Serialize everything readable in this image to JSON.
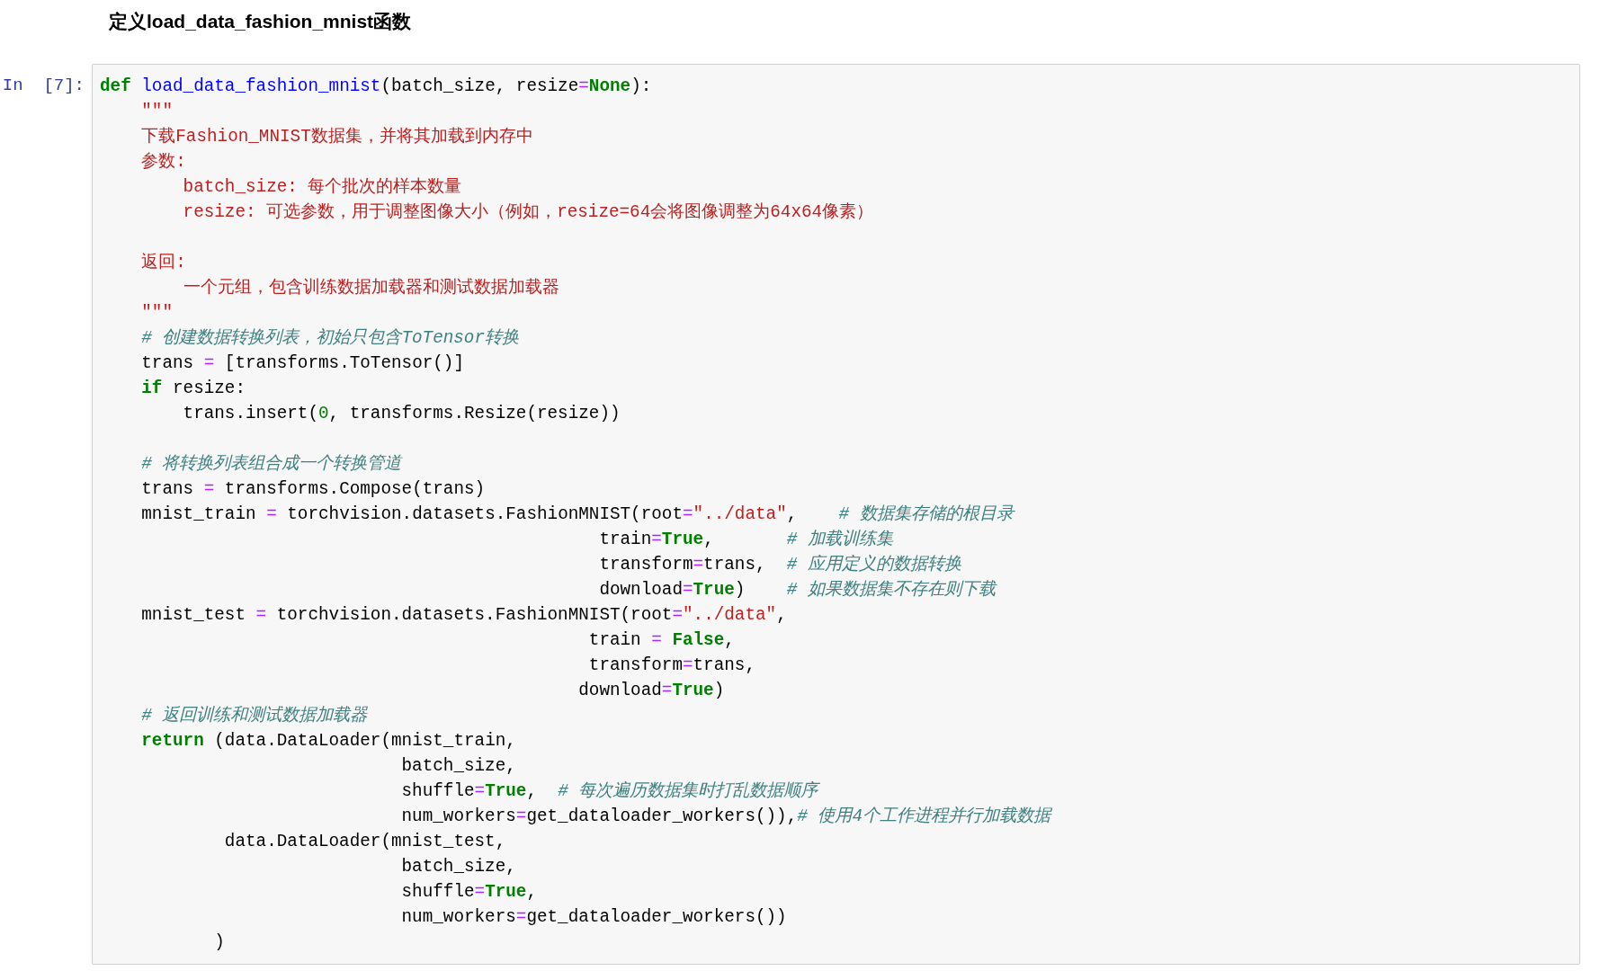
{
  "heading": "定义load_data_fashion_mnist函数",
  "cell": {
    "prompt": "In  [7]:",
    "lines": [
      {
        "kind": "code",
        "tokens": [
          {
            "kind": "kw",
            "text": "def"
          },
          {
            "kind": "fn",
            "text": " load_data_fashion_mnist"
          },
          {
            "kind": "txt",
            "text": "(batch_size, resize"
          },
          {
            "kind": "op",
            "text": "="
          },
          {
            "kind": "kw",
            "text": "None"
          },
          {
            "kind": "txt",
            "text": "):"
          }
        ]
      },
      {
        "kind": "code",
        "tokens": [
          {
            "kind": "str",
            "text": "    \"\"\""
          }
        ]
      },
      {
        "kind": "code",
        "tokens": [
          {
            "kind": "str",
            "text": "    下载Fashion_MNIST数据集，并将其加载到内存中"
          }
        ]
      },
      {
        "kind": "code",
        "tokens": [
          {
            "kind": "str",
            "text": "    参数:"
          }
        ]
      },
      {
        "kind": "code",
        "tokens": [
          {
            "kind": "str",
            "text": "        batch_size: 每个批次的样本数量"
          }
        ]
      },
      {
        "kind": "code",
        "tokens": [
          {
            "kind": "str",
            "text": "        resize: 可选参数，用于调整图像大小（例如，resize=64会将图像调整为64x64像素）"
          }
        ]
      },
      {
        "kind": "blank"
      },
      {
        "kind": "code",
        "tokens": [
          {
            "kind": "str",
            "text": "    返回:"
          }
        ]
      },
      {
        "kind": "code",
        "tokens": [
          {
            "kind": "str",
            "text": "        一个元组，包含训练数据加载器和测试数据加载器"
          }
        ]
      },
      {
        "kind": "code",
        "tokens": [
          {
            "kind": "str",
            "text": "    \"\"\""
          }
        ]
      },
      {
        "kind": "code",
        "tokens": [
          {
            "kind": "cmt",
            "text": "    # 创建数据转换列表，初始只包含ToTensor转换"
          }
        ]
      },
      {
        "kind": "code",
        "tokens": [
          {
            "kind": "txt",
            "text": "    trans "
          },
          {
            "kind": "op",
            "text": "="
          },
          {
            "kind": "txt",
            "text": " [transforms.ToTensor()]"
          }
        ]
      },
      {
        "kind": "code",
        "tokens": [
          {
            "kind": "kw",
            "text": "    if"
          },
          {
            "kind": "txt",
            "text": " resize:"
          }
        ]
      },
      {
        "kind": "code",
        "tokens": [
          {
            "kind": "txt",
            "text": "        trans.insert("
          },
          {
            "kind": "num",
            "text": "0"
          },
          {
            "kind": "txt",
            "text": ", transforms.Resize(resize))"
          }
        ]
      },
      {
        "kind": "blank"
      },
      {
        "kind": "code",
        "tokens": [
          {
            "kind": "cmt",
            "text": "    # 将转换列表组合成一个转换管道"
          }
        ]
      },
      {
        "kind": "code",
        "tokens": [
          {
            "kind": "txt",
            "text": "    trans "
          },
          {
            "kind": "op",
            "text": "="
          },
          {
            "kind": "txt",
            "text": " transforms.Compose(trans)"
          }
        ]
      },
      {
        "kind": "code",
        "tokens": [
          {
            "kind": "txt",
            "text": "    mnist_train "
          },
          {
            "kind": "op",
            "text": "="
          },
          {
            "kind": "txt",
            "text": " torchvision.datasets.FashionMNIST(root"
          },
          {
            "kind": "op",
            "text": "="
          },
          {
            "kind": "str",
            "text": "\"../data\""
          },
          {
            "kind": "txt",
            "text": ",    "
          },
          {
            "kind": "cmt",
            "text": "# 数据集存储的根目录"
          }
        ]
      },
      {
        "kind": "code",
        "tokens": [
          {
            "kind": "txt",
            "text": "                                                train"
          },
          {
            "kind": "op",
            "text": "="
          },
          {
            "kind": "kw",
            "text": "True"
          },
          {
            "kind": "txt",
            "text": ",       "
          },
          {
            "kind": "cmt",
            "text": "# 加载训练集"
          }
        ]
      },
      {
        "kind": "code",
        "tokens": [
          {
            "kind": "txt",
            "text": "                                                transform"
          },
          {
            "kind": "op",
            "text": "="
          },
          {
            "kind": "txt",
            "text": "trans,  "
          },
          {
            "kind": "cmt",
            "text": "# 应用定义的数据转换"
          }
        ]
      },
      {
        "kind": "code",
        "tokens": [
          {
            "kind": "txt",
            "text": "                                                download"
          },
          {
            "kind": "op",
            "text": "="
          },
          {
            "kind": "kw",
            "text": "True"
          },
          {
            "kind": "txt",
            "text": ")    "
          },
          {
            "kind": "cmt",
            "text": "# 如果数据集不存在则下载"
          }
        ]
      },
      {
        "kind": "code",
        "tokens": [
          {
            "kind": "txt",
            "text": "    mnist_test "
          },
          {
            "kind": "op",
            "text": "="
          },
          {
            "kind": "txt",
            "text": " torchvision.datasets.FashionMNIST(root"
          },
          {
            "kind": "op",
            "text": "="
          },
          {
            "kind": "str",
            "text": "\"../data\""
          },
          {
            "kind": "txt",
            "text": ","
          }
        ]
      },
      {
        "kind": "code",
        "tokens": [
          {
            "kind": "txt",
            "text": "                                               train "
          },
          {
            "kind": "op",
            "text": "="
          },
          {
            "kind": "kw",
            "text": " False"
          },
          {
            "kind": "txt",
            "text": ","
          }
        ]
      },
      {
        "kind": "code",
        "tokens": [
          {
            "kind": "txt",
            "text": "                                               transform"
          },
          {
            "kind": "op",
            "text": "="
          },
          {
            "kind": "txt",
            "text": "trans,"
          }
        ]
      },
      {
        "kind": "code",
        "tokens": [
          {
            "kind": "txt",
            "text": "                                              download"
          },
          {
            "kind": "op",
            "text": "="
          },
          {
            "kind": "kw",
            "text": "True"
          },
          {
            "kind": "txt",
            "text": ")"
          }
        ]
      },
      {
        "kind": "code",
        "tokens": [
          {
            "kind": "cmt",
            "text": "    # 返回训练和测试数据加载器"
          }
        ]
      },
      {
        "kind": "code",
        "tokens": [
          {
            "kind": "kw",
            "text": "    return"
          },
          {
            "kind": "txt",
            "text": " (data.DataLoader(mnist_train,"
          }
        ]
      },
      {
        "kind": "code",
        "tokens": [
          {
            "kind": "txt",
            "text": "                             batch_size,"
          }
        ]
      },
      {
        "kind": "code",
        "tokens": [
          {
            "kind": "txt",
            "text": "                             shuffle"
          },
          {
            "kind": "op",
            "text": "="
          },
          {
            "kind": "kw",
            "text": "True"
          },
          {
            "kind": "txt",
            "text": ",  "
          },
          {
            "kind": "cmt",
            "text": "# 每次遍历数据集时打乱数据顺序"
          }
        ]
      },
      {
        "kind": "code",
        "tokens": [
          {
            "kind": "txt",
            "text": "                             num_workers"
          },
          {
            "kind": "op",
            "text": "="
          },
          {
            "kind": "txt",
            "text": "get_dataloader_workers()),"
          },
          {
            "kind": "cmt",
            "text": "# 使用4个工作进程并行加载数据"
          }
        ]
      },
      {
        "kind": "code",
        "tokens": [
          {
            "kind": "txt",
            "text": "            data.DataLoader(mnist_test,"
          }
        ]
      },
      {
        "kind": "code",
        "tokens": [
          {
            "kind": "txt",
            "text": "                             batch_size,"
          }
        ]
      },
      {
        "kind": "code",
        "tokens": [
          {
            "kind": "txt",
            "text": "                             shuffle"
          },
          {
            "kind": "op",
            "text": "="
          },
          {
            "kind": "kw",
            "text": "True"
          },
          {
            "kind": "txt",
            "text": ","
          }
        ]
      },
      {
        "kind": "code",
        "tokens": [
          {
            "kind": "txt",
            "text": "                             num_workers"
          },
          {
            "kind": "op",
            "text": "="
          },
          {
            "kind": "txt",
            "text": "get_dataloader_workers())"
          }
        ]
      },
      {
        "kind": "code",
        "tokens": [
          {
            "kind": "txt",
            "text": "           )"
          }
        ]
      }
    ]
  }
}
